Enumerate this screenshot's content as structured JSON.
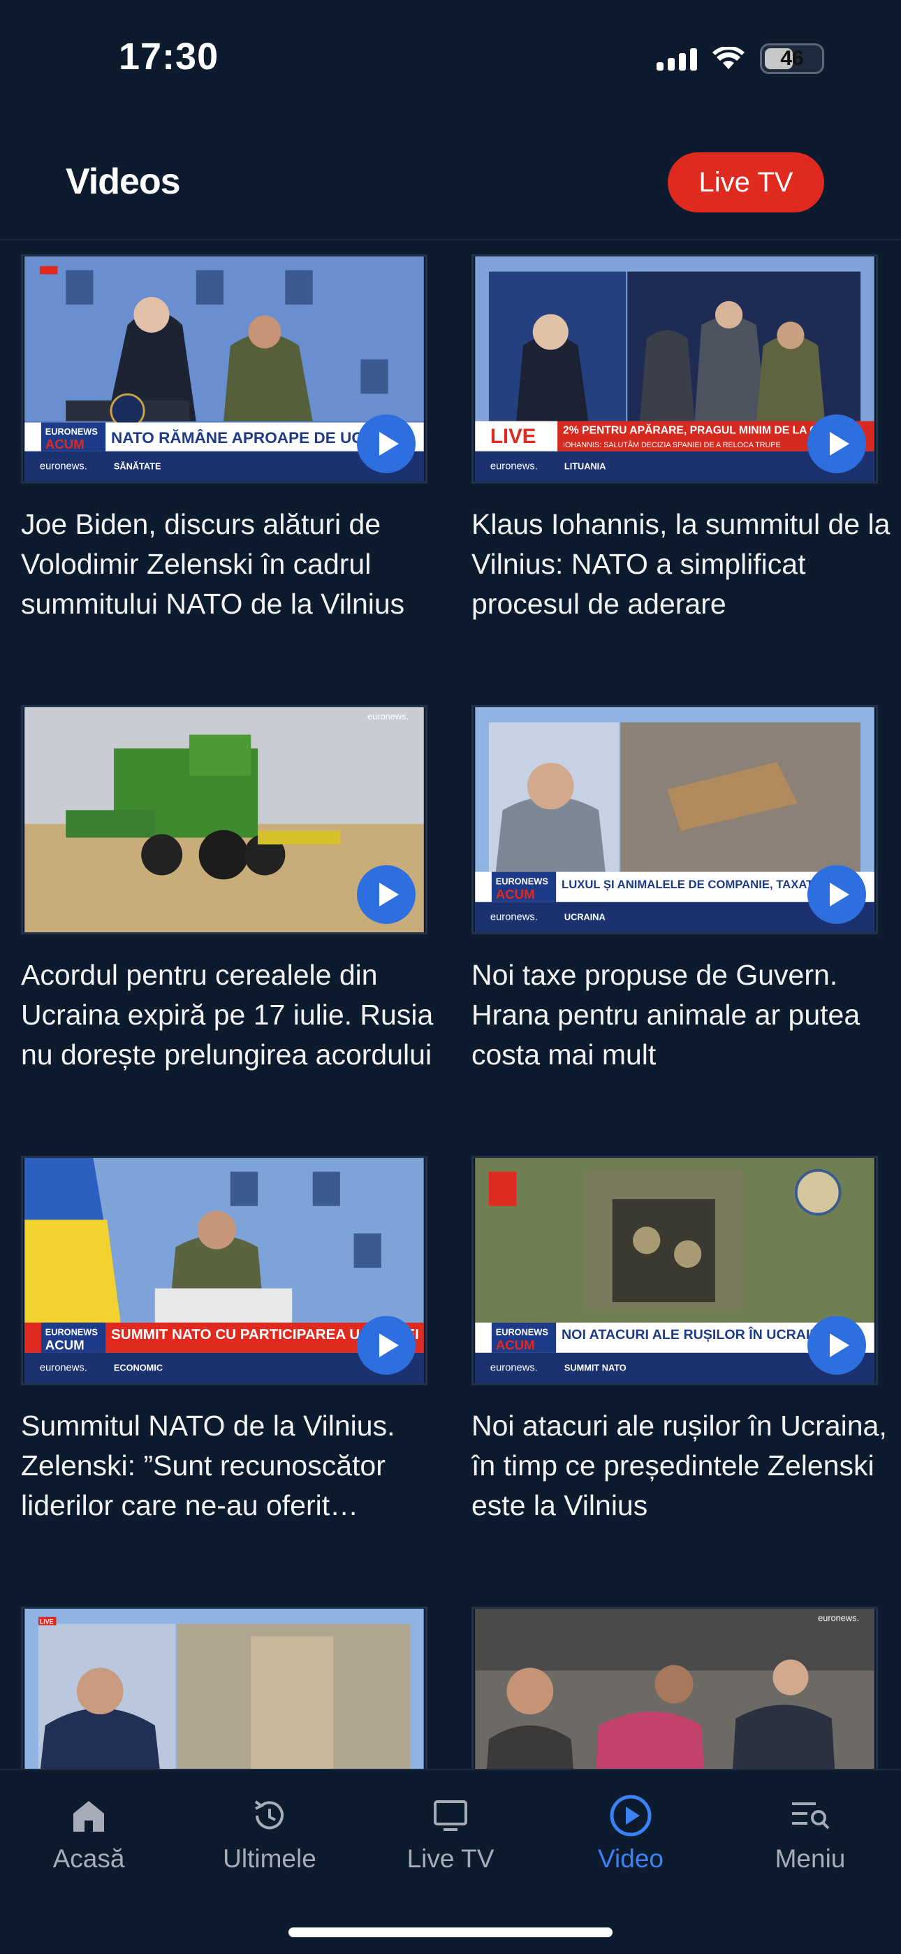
{
  "status_bar": {
    "time": "17:30",
    "battery": "46"
  },
  "header": {
    "title": "Videos",
    "live_tv_button": "Live TV"
  },
  "videos": [
    {
      "title": "Joe Biden, discurs alături de Volodimir Zelenski în cadrul summitului NATO de la Vilnius",
      "thumb_banner": "NATO RĂMÂNE APROAPE DE UCRAINA",
      "thumb_brand": "EURONEWS ACUM",
      "thumb_section": "SĂNĂTATE"
    },
    {
      "title": "Klaus Iohannis, la summitul de la Vilnius: NATO a simplificat procesul de aderare",
      "thumb_banner": "2% PENTRU APĂRARE, PRAGUL MINIM DE LA CARE",
      "thumb_brand": "LIVE",
      "thumb_section": "LITUANIA"
    },
    {
      "title": "Acordul pentru cerealele din Ucraina expiră pe 17 iulie. Rusia nu dorește prelungirea acordului",
      "thumb_banner": "",
      "thumb_brand": "euronews.",
      "thumb_section": ""
    },
    {
      "title": "Noi taxe propuse de Guvern. Hrana pentru animale ar putea costa mai mult",
      "thumb_banner": "LUXUL ȘI ANIMALELE DE COMPANIE, TAXATE DE",
      "thumb_brand": "EURONEWS ACUM",
      "thumb_section": "UCRAINA"
    },
    {
      "title": "Summitul NATO de la Vilnius. Zelenski: ”Sunt recunoscător liderilor care ne-au oferit asistență”",
      "thumb_banner": "SUMMIT NATO CU PARTICIPAREA UCRAINEI",
      "thumb_brand": "EURONEWS ACUM",
      "thumb_section": "ECONOMIC"
    },
    {
      "title": "Noi atacuri ale rușilor în Ucraina, în timp ce președintele Zelenski este la Vilnius",
      "thumb_banner": "NOI ATACURI ALE RUȘILOR ÎN UCRAINA",
      "thumb_brand": "EURONEWS ACUM",
      "thumb_section": "SUMMIT NATO"
    },
    {
      "title": "",
      "thumb_banner": "",
      "thumb_brand": "LIVE",
      "thumb_section": ""
    },
    {
      "title": "",
      "thumb_banner": "",
      "thumb_brand": "euronews.",
      "thumb_section": ""
    }
  ],
  "bottom_nav": [
    {
      "label": "Acasă",
      "icon": "home-icon"
    },
    {
      "label": "Ultimele",
      "icon": "history-icon"
    },
    {
      "label": "Live TV",
      "icon": "tv-icon"
    },
    {
      "label": "Video",
      "icon": "play-circle-icon",
      "active": true
    },
    {
      "label": "Meniu",
      "icon": "menu-search-icon"
    }
  ],
  "colors": {
    "background": "#0d1b2e",
    "accent_red": "#e0291f",
    "accent_blue": "#3b82f6",
    "play_blue": "#2e6fe0"
  }
}
